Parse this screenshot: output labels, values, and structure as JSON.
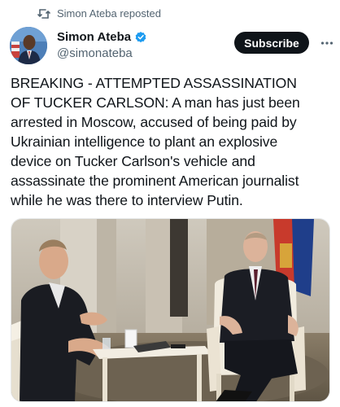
{
  "repost": {
    "icon": "repost-icon",
    "label": "Simon Ateba reposted"
  },
  "author": {
    "name": "Simon Ateba",
    "handle": "@simonateba",
    "verified_color": "#1d9bf0"
  },
  "actions": {
    "subscribe_label": "Subscribe",
    "more_icon": "more-icon"
  },
  "tweet": {
    "text": "BREAKING - ATTEMPTED ASSASSINATION\nOF TUCKER CARLSON: A man has just been\narrested in Moscow, accused of being paid by\nUkrainian intelligence to plant an explosive\ndevice on Tucker Carlson's vehicle and\nassassinate the prominent American journalist\nwhile he was there to interview Putin."
  },
  "media": {
    "type": "photo"
  }
}
